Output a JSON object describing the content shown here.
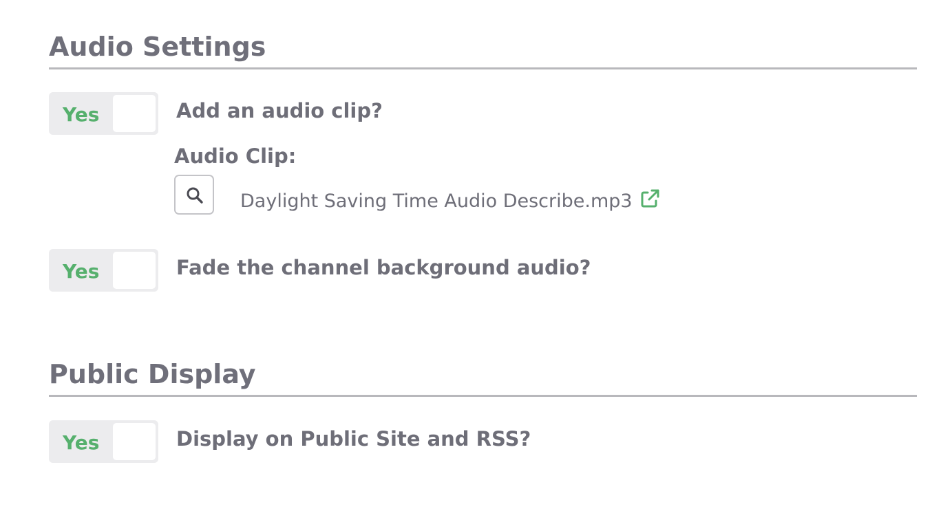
{
  "audio_settings": {
    "title": "Audio Settings",
    "add_clip": {
      "toggle_label": "Yes",
      "question": "Add an audio clip?"
    },
    "audio_clip": {
      "label": "Audio Clip:",
      "file_name": "Daylight Saving Time Audio Describe.mp3"
    },
    "fade_background": {
      "toggle_label": "Yes",
      "question": "Fade the channel background audio?"
    }
  },
  "public_display": {
    "title": "Public Display",
    "display_public": {
      "toggle_label": "Yes",
      "question": "Display on Public Site and RSS?"
    }
  },
  "colors": {
    "toggle_on_text": "#56b06d",
    "heading_text": "#6f6f7a",
    "body_text": "#6e6e78",
    "rule": "#b8b8bc",
    "toggle_track": "#ececee",
    "link_icon": "#56b06d"
  },
  "icons": {
    "search": "search-icon",
    "external_link": "external-link-icon"
  }
}
